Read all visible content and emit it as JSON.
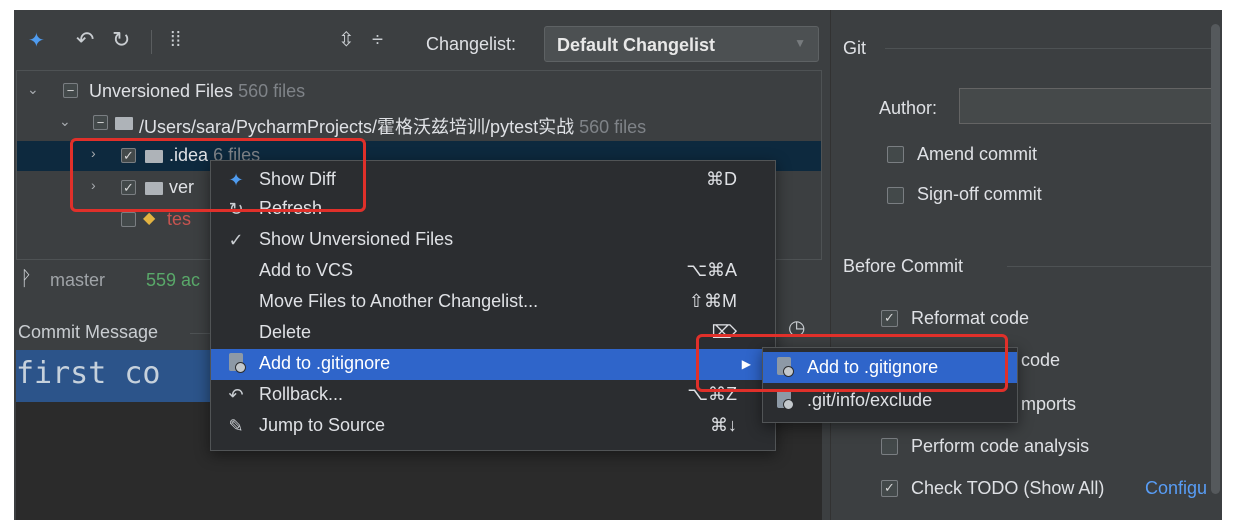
{
  "toolbar": {
    "changelist_label": "Changelist:",
    "changelist_value": "Default Changelist"
  },
  "tree": {
    "root": {
      "label": "Unversioned Files",
      "count": "560 files"
    },
    "path": {
      "label": "/Users/sara/PycharmProjects/霍格沃兹培训/pytest实战",
      "count": "560 files"
    },
    "idea": {
      "label": ".idea",
      "count": "6 files"
    },
    "venv": {
      "label": "ver"
    },
    "testfile": {
      "label": "tes"
    }
  },
  "status": {
    "branch": "master",
    "added": "559 ac"
  },
  "commit": {
    "header": "Commit Message",
    "text": "first co"
  },
  "context_menu": {
    "items": [
      {
        "label": "Show Diff",
        "shortcut": "⌘D",
        "icon": "show-diff-icon"
      },
      {
        "label": "Refresh",
        "shortcut": "",
        "icon": "refresh-icon"
      },
      {
        "label": "Show Unversioned Files",
        "shortcut": "",
        "icon": "checkmark-icon"
      },
      {
        "label": "Add to VCS",
        "shortcut": "⌥⌘A",
        "icon": ""
      },
      {
        "label": "Move Files to Another Changelist...",
        "shortcut": "⇧⌘M",
        "icon": ""
      },
      {
        "label": "Delete",
        "shortcut": "⌦",
        "icon": ""
      },
      {
        "label": "Add to .gitignore",
        "shortcut": "",
        "icon": "gitignore-icon"
      },
      {
        "label": "Rollback...",
        "shortcut": "⌥⌘Z",
        "icon": "rollback-icon"
      },
      {
        "label": "Jump to Source",
        "shortcut": "⌘↓",
        "icon": "jump-to-source-icon"
      }
    ]
  },
  "submenu": {
    "items": [
      {
        "label": "Add to .gitignore"
      },
      {
        "label": ".git/info/exclude"
      }
    ]
  },
  "git_panel": {
    "title": "Git",
    "author_label": "Author:",
    "author_value": "",
    "amend": "Amend commit",
    "signoff": "Sign-off commit",
    "before_commit": "Before Commit",
    "reformat": "Reformat code",
    "rearrange": "code",
    "optimize": "mports",
    "analysis": "Perform code analysis",
    "todo": "Check TODO (Show All)",
    "configure": "Configu"
  },
  "colors": {
    "panel_bg": "#3c3f41",
    "menu_bg": "#2b2d30",
    "selection": "#2f65ca",
    "highlight": "#e0302a",
    "link": "#589df6"
  }
}
